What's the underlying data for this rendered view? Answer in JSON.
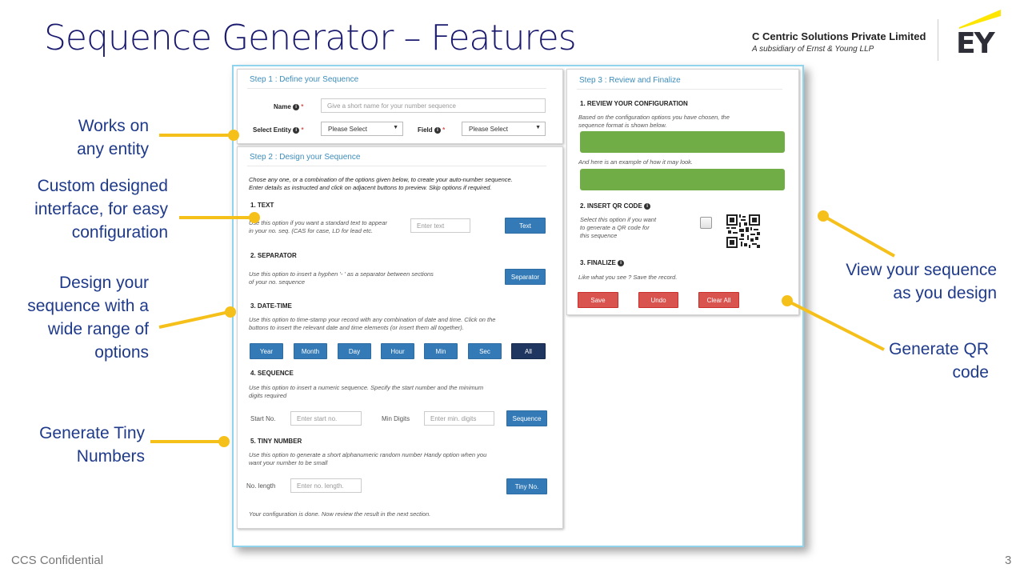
{
  "slide": {
    "title": "Sequence Generator – Features",
    "company_name": "C Centric Solutions Private Limited",
    "company_sub": "A subsidiary of Ernst & Young LLP",
    "logo_text": "EY",
    "footer_left": "CCS Confidential",
    "page_number": "3"
  },
  "callouts": {
    "any_entity": [
      "Works on",
      "any entity"
    ],
    "custom_interface": [
      "Custom designed",
      "interface, for easy",
      "configuration"
    ],
    "design_sequence": [
      "Design your",
      "sequence with a",
      "wide range of",
      "options"
    ],
    "tiny_numbers": [
      "Generate Tiny",
      "Numbers"
    ],
    "view_sequence": [
      "View your sequence",
      "as you design"
    ],
    "qr_code": [
      "Generate QR",
      "code"
    ]
  },
  "colors": {
    "accent": "#337ab7",
    "connector": "#f6c01a",
    "green": "#70ad47",
    "danger": "#d9534f",
    "title": "#1a1a6e"
  },
  "step1": {
    "title": "Step 1 : Define your Sequence",
    "name_label": "Name",
    "name_placeholder": "Give a short name for your number sequence",
    "entity_label": "Select Entity",
    "entity_value": "Please Select",
    "field_label": "Field",
    "field_value": "Please Select"
  },
  "step2": {
    "title": "Step 2 : Design your Sequence",
    "intro_line1": "Chose any one, or a combination of the options given below, to create your auto-number sequence.",
    "intro_line2": "Enter details as instructed and click on adjacent buttons to preview. Skip options if required.",
    "text": {
      "head": "1. TEXT",
      "desc1": "Use this option if you want a standard text to appear",
      "desc2": "in your no. seq. (CAS for case, LD for lead etc.",
      "placeholder": "Enter text",
      "button": "Text"
    },
    "separator": {
      "head": "2. SEPARATOR",
      "desc1": "Use this option to insert a hyphen '- ' as a separator between sections",
      "desc2": "of your no. sequence",
      "button": "Separator"
    },
    "datetime": {
      "head": "3. DATE-TIME",
      "desc1": "Use this option to time-stamp your record with any combination of date and time. Click on the",
      "desc2": "buttons to insert the relevant date and time elements (or insert them all together).",
      "buttons": [
        "Year",
        "Month",
        "Day",
        "Hour",
        "Min",
        "Sec",
        "All"
      ]
    },
    "sequence": {
      "head": "4. SEQUENCE",
      "desc1": "Use this option to insert a numeric sequence. Specify the start number and the minimum",
      "desc2": "digits required",
      "start_label": "Start No.",
      "start_placeholder": "Enter start no.",
      "digits_label": "Min Digits",
      "digits_placeholder": "Enter min. digits",
      "button": "Sequence"
    },
    "tiny": {
      "head": "5. TINY NUMBER",
      "desc1": "Use this option to generate a short alphanumeric random number Handy option when you",
      "desc2": "want your number to be small",
      "length_label": "No. length",
      "length_placeholder": "Enter no. length.",
      "button": "Tiny No."
    },
    "footer_note": "Your configuration is done. Now review the result in the next section."
  },
  "step3": {
    "title": "Step 3 : Review and Finalize",
    "review_head": "1. REVIEW YOUR CONFIGURATION",
    "review_desc1": "Based on the configuration options you have chosen, the",
    "review_desc2": "sequence format is shown below.",
    "example_text": "And here is an example of how it may look.",
    "qr_head": "2. INSERT QR CODE",
    "qr_desc1": "Select this option if you want",
    "qr_desc2": "to generate a QR code for",
    "qr_desc3": "this sequence",
    "finalize_head": "3. FINALIZE",
    "finalize_desc": "Like what you see ? Save the record.",
    "save_button": "Save",
    "undo_button": "Undo",
    "clear_button": "Clear All"
  }
}
